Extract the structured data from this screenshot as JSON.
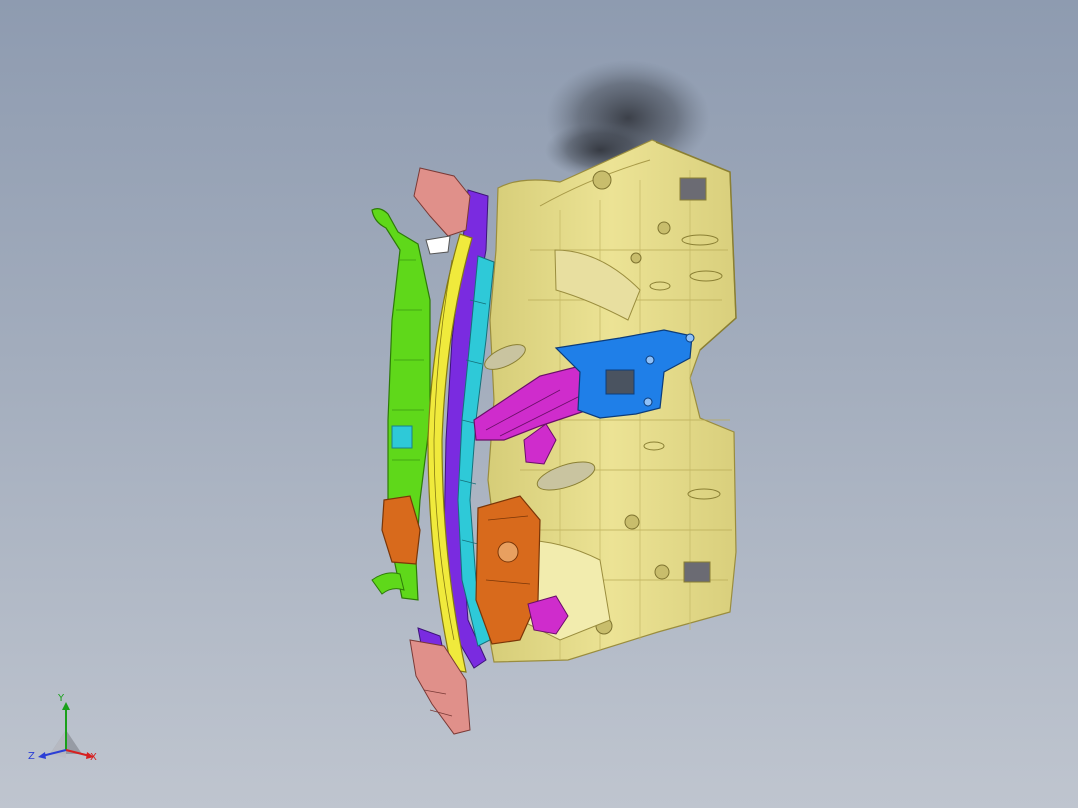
{
  "viewport": {
    "background_top": "#8e9bb0",
    "background_bottom": "#bfc5cf"
  },
  "model": {
    "part_colors": {
      "main_panel": "#e2d98a",
      "panel_edge": "#9a8d3e",
      "outer_rail": "#5fd81a",
      "inner_strip": "#7a2be0",
      "arc_rail": "#f0ea3c",
      "cyan_member": "#2ec9d8",
      "magenta_brace": "#cf2ccc",
      "blue_bracket": "#1f7fe8",
      "orange_plate": "#d86a1c",
      "salmon_tip": "#e0908a"
    }
  },
  "triad": {
    "x_label": "X",
    "y_label": "Y",
    "z_label": "Z",
    "x_color": "#d62020",
    "y_color": "#1aa01a",
    "z_color": "#2b3fd6"
  }
}
